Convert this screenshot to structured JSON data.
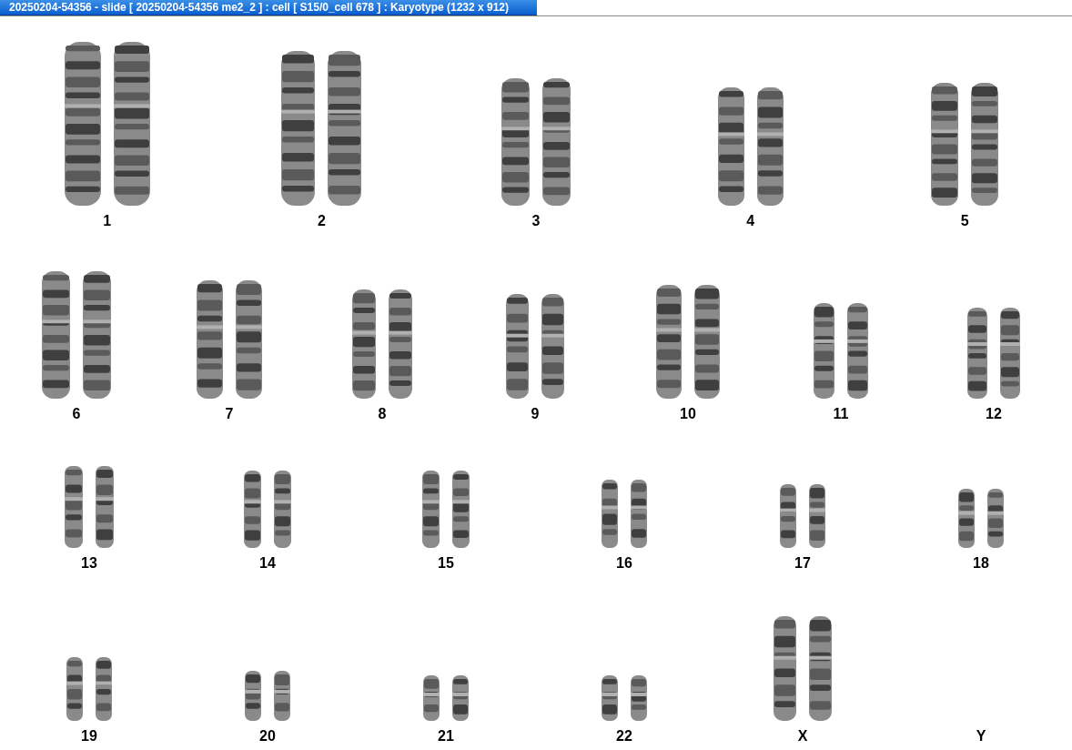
{
  "window": {
    "title": "20250204-54356 - slide [ 20250204-54356 me2_2 ] : cell [ S15/0_cell 678 ] : Karyotype  (1232 x 912)"
  },
  "karyotype": {
    "rows": [
      {
        "chromosomes": [
          {
            "label": "1",
            "kind": "pair"
          },
          {
            "label": "2",
            "kind": "pair"
          },
          {
            "label": "3",
            "kind": "pair"
          },
          {
            "label": "4",
            "kind": "pair"
          },
          {
            "label": "5",
            "kind": "pair"
          }
        ]
      },
      {
        "chromosomes": [
          {
            "label": "6",
            "kind": "pair"
          },
          {
            "label": "7",
            "kind": "pair"
          },
          {
            "label": "8",
            "kind": "pair"
          },
          {
            "label": "9",
            "kind": "pair"
          },
          {
            "label": "10",
            "kind": "pair"
          },
          {
            "label": "11",
            "kind": "pair"
          },
          {
            "label": "12",
            "kind": "pair"
          }
        ]
      },
      {
        "chromosomes": [
          {
            "label": "13",
            "kind": "pair"
          },
          {
            "label": "14",
            "kind": "pair"
          },
          {
            "label": "15",
            "kind": "pair"
          },
          {
            "label": "16",
            "kind": "pair"
          },
          {
            "label": "17",
            "kind": "pair"
          },
          {
            "label": "18",
            "kind": "pair"
          }
        ]
      },
      {
        "chromosomes": [
          {
            "label": "19",
            "kind": "pair"
          },
          {
            "label": "20",
            "kind": "pair"
          },
          {
            "label": "21",
            "kind": "pair"
          },
          {
            "label": "22",
            "kind": "pair"
          },
          {
            "label": "X",
            "kind": "pair"
          },
          {
            "label": "Y",
            "kind": "empty"
          }
        ]
      }
    ]
  }
}
